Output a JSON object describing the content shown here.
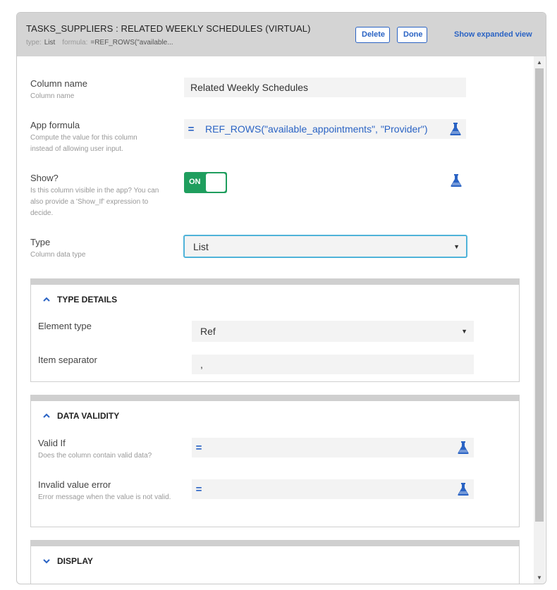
{
  "header": {
    "title": "TASKS_SUPPLIERS : RELATED WEEKLY SCHEDULES (VIRTUAL)",
    "type_label": "type:",
    "type_value": "List",
    "formula_label": "formula:",
    "formula_value": "=REF_ROWS(\"available...",
    "delete_label": "Delete",
    "done_label": "Done",
    "expanded_label": "Show expanded view"
  },
  "fields": {
    "column_name": {
      "label": "Column name",
      "help": "Column name",
      "value": "Related Weekly Schedules"
    },
    "app_formula": {
      "label": "App formula",
      "help": "Compute the value for this column instead of allowing user input.",
      "eq": "=",
      "value": "REF_ROWS(\"available_appointments\", \"Provider\")"
    },
    "show": {
      "label": "Show?",
      "help": "Is this column visible in the app? You can also provide a 'Show_If' expression to decide.",
      "toggle_label": "ON"
    },
    "type": {
      "label": "Type",
      "help": "Column data type",
      "value": "List"
    }
  },
  "sections": {
    "type_details": {
      "title": "TYPE DETAILS",
      "element_type_label": "Element type",
      "element_type_value": "Ref",
      "item_separator_label": "Item separator",
      "item_separator_value": ","
    },
    "data_validity": {
      "title": "DATA VALIDITY",
      "valid_if_label": "Valid If",
      "valid_if_help": "Does the column contain valid data?",
      "invalid_error_label": "Invalid value error",
      "invalid_error_help": "Error message when the value is not valid.",
      "eq": "="
    },
    "display": {
      "title": "DISPLAY"
    }
  },
  "colors": {
    "accent": "#2a63c4",
    "toggle_on": "#1f9e5e",
    "focus_border": "#4fb3d9",
    "header_bg": "#d4d4d4"
  },
  "icons": {
    "flask": "flask-icon",
    "chevron_up": "chevron-up-icon",
    "chevron_down": "chevron-down-icon",
    "select_arrow": "▼"
  }
}
